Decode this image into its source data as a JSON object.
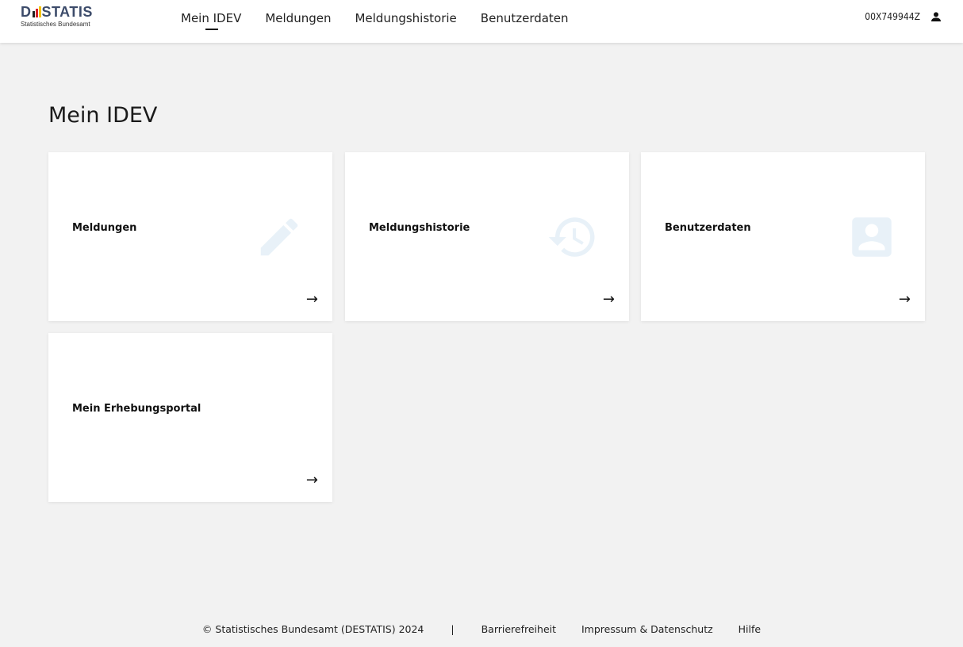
{
  "header": {
    "logo_text": "DESTATIS",
    "logo_sub": "Statistisches Bundesamt",
    "nav": [
      {
        "label": "Mein IDEV"
      },
      {
        "label": "Meldungen"
      },
      {
        "label": "Meldungshistorie"
      },
      {
        "label": "Benutzerdaten"
      }
    ],
    "user_id": "00X749944Z",
    "user_icon": "person-icon"
  },
  "main": {
    "title": "Mein IDEV",
    "cards": [
      {
        "title": "Meldungen",
        "icon": "pencil-icon",
        "arrow": "→"
      },
      {
        "title": "Meldungshistorie",
        "icon": "history-icon",
        "arrow": "→"
      },
      {
        "title": "Benutzerdaten",
        "icon": "account-box-icon",
        "arrow": "→"
      },
      {
        "title": "Mein Erhebungsportal",
        "icon": "",
        "arrow": "→"
      }
    ]
  },
  "footer": {
    "copyright": "© Statistisches Bundesamt (DESTATIS) 2024",
    "separator": "|",
    "links": [
      "Barrierefreiheit",
      "Impressum & Datenschutz",
      "Hilfe"
    ]
  },
  "colors": {
    "background": "#f2f2f2",
    "card": "#ffffff",
    "icon_tint": "#e8f1f8",
    "logo": "#3c4b6a"
  }
}
